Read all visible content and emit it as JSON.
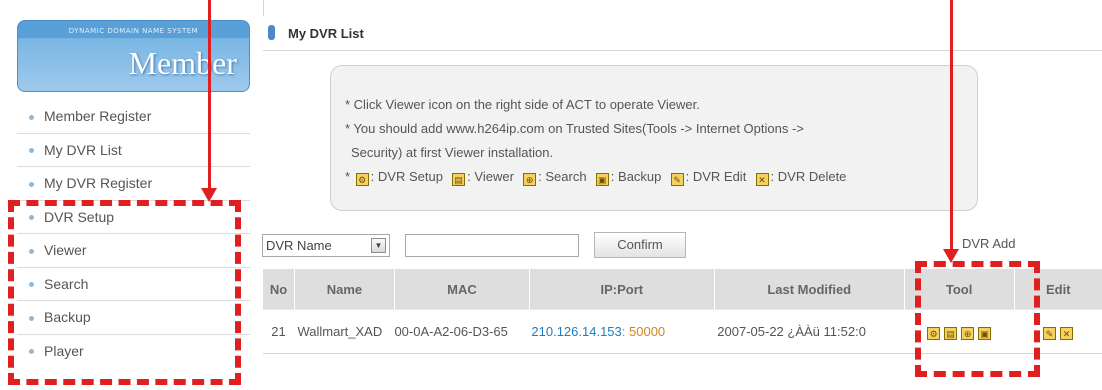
{
  "sidebar": {
    "banner_top": "DYNAMIC DOMAIN NAME SYSTEM",
    "banner_title": "Member",
    "items": [
      {
        "label": "Member Register"
      },
      {
        "label": "My DVR List"
      },
      {
        "label": "My DVR Register"
      },
      {
        "label": "DVR Setup"
      },
      {
        "label": "Viewer"
      },
      {
        "label": "Search"
      },
      {
        "label": "Backup"
      },
      {
        "label": "Player"
      }
    ]
  },
  "main": {
    "title": "My DVR List",
    "info": {
      "line1": "* Click Viewer icon on the right side of ACT to operate Viewer.",
      "line2": "* You should add www.h264ip.com on Trusted Sites(Tools -> Internet Options ->",
      "line3": "Security) at first  Viewer installation.",
      "legend_prefix": "* ",
      "legend": {
        "setup": ": DVR Setup",
        "viewer": ": Viewer",
        "search": ": Search",
        "backup": ": Backup",
        "edit": ": DVR Edit",
        "delete": ": DVR Delete"
      }
    },
    "search": {
      "select_value": "DVR Name",
      "input_value": "",
      "confirm_label": "Confirm"
    },
    "dvr_add_label": "DVR Add",
    "table": {
      "headers": [
        "No",
        "Name",
        "MAC",
        "IP:Port",
        "Last Modified",
        "Tool",
        "Edit"
      ],
      "rows": [
        {
          "no": "21",
          "name": "Wallmart_XAD",
          "mac": "00-0A-A2-06-D3-65",
          "ip": "210.126.14.153",
          "colon": ":",
          "port": "50000",
          "modified": "2007-05-22 ¿ÀÀü 11:52:0"
        }
      ]
    }
  },
  "colors": {
    "annotation": "#e02020",
    "accent": "#4c87c8",
    "ip": "#1f7cc0",
    "port": "#d4851a"
  }
}
